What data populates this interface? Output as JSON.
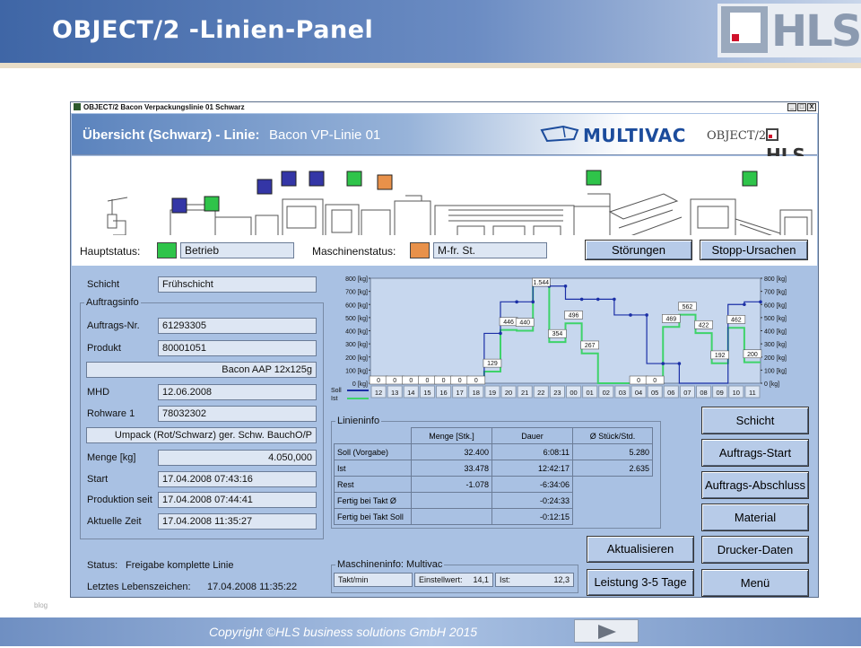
{
  "slide": {
    "title": "OBJECT/2 -Linien-Panel",
    "logo_text": "HLS",
    "footer_copyright": "Copyright ©HLS business solutions GmbH 2015",
    "blog_mark": "blog"
  },
  "window": {
    "title": "OBJECT/2 Bacon Verpackungslinie 01 Schwarz",
    "btn_min": "_",
    "btn_max": "□",
    "btn_close": "X"
  },
  "header": {
    "overview_label": "Übersicht (Schwarz) -  Linie:",
    "line_name": "Bacon VP-Linie 01",
    "brand": "MULTIVAC",
    "product_logo": "OBJECT/2",
    "hls_logo": "HLS"
  },
  "status": {
    "haupt_label": "Hauptstatus:",
    "haupt_value": "Betrieb",
    "haupt_color": "#2fc44a",
    "maschine_label": "Maschinenstatus:",
    "maschine_value": "M-fr. St.",
    "maschine_color": "#e8914a",
    "stoerungen": "Störungen",
    "stopp": "Stopp-Ursachen"
  },
  "machine_markers": {
    "blue": "#3436a6",
    "green": "#2fc44a",
    "orange": "#e8914a"
  },
  "left": {
    "schicht_label": "Schicht",
    "schicht_value": "Frühschicht",
    "auftragsinfo": "Auftragsinfo",
    "auftrag_label": "Auftrags-Nr.",
    "auftrag_value": "61293305",
    "produkt_label": "Produkt",
    "produkt_value": "80001051",
    "produkt_desc": "Bacon AAP 12x125g",
    "mhd_label": "MHD",
    "mhd_value": "12.06.2008",
    "rohware_label": "Rohware 1",
    "rohware_value": "78032302",
    "rohware_desc": "Umpack (Rot/Schwarz) ger. Schw. BauchO/P",
    "menge_label": "Menge [kg]",
    "menge_value": "4.050,000",
    "start_label": "Start",
    "start_value": "17.04.2008 07:43:16",
    "prod_label": "Produktion seit",
    "prod_value": "17.04.2008 07:44:41",
    "zeit_label": "Aktuelle Zeit",
    "zeit_value": "17.04.2008 11:35:27",
    "status_label": "Status:",
    "status_value": "Freigabe komplette Linie",
    "leben_label": "Letztes Lebenszeichen:",
    "leben_value": "17.04.2008 11:35:22"
  },
  "linieninfo": {
    "title": "Linieninfo",
    "headers": [
      "Menge [Stk.]",
      "Dauer",
      "Ø Stück/Std."
    ],
    "rows": [
      {
        "label": "Soll (Vorgabe)",
        "c1": "32.400",
        "c2": "6:08:11",
        "c3": "5.280"
      },
      {
        "label": "Ist",
        "c1": "33.478",
        "c2": "12:42:17",
        "c3": "2.635"
      },
      {
        "label": "Rest",
        "c1": "-1.078",
        "c2": "-6:34:06",
        "c3": ""
      },
      {
        "label": "Fertig bei Takt Ø",
        "c1": "",
        "c2": "-0:24:33",
        "c3": ""
      },
      {
        "label": "Fertig bei Takt Soll",
        "c1": "",
        "c2": "-0:12:15",
        "c3": ""
      }
    ]
  },
  "maschineninfo": {
    "title": "Maschineninfo: Multivac",
    "takt_label": "Takt/min",
    "einstell_label": "Einstellwert:",
    "einstell_value": "14,1",
    "ist_label": "Ist:",
    "ist_value": "12,3"
  },
  "buttons": {
    "schicht": "Schicht",
    "auftrags_start": "Auftrags-Start",
    "auftrags_abschluss": "Auftrags-Abschluss",
    "material": "Material",
    "drucker": "Drucker-Daten",
    "menu": "Menü",
    "aktualisieren": "Aktualisieren",
    "leistung": "Leistung 3-5 Tage"
  },
  "chart_data": {
    "type": "line",
    "y_unit": "[kg]",
    "ylim": [
      0,
      800
    ],
    "yticks": [
      "800 [kg]",
      "700 [kg]",
      "600 [kg]",
      "500 [kg]",
      "400 [kg]",
      "300 [kg]",
      "200 [kg]",
      "100 [kg]",
      "0 [kg]"
    ],
    "categories": [
      "12",
      "13",
      "14",
      "15",
      "16",
      "17",
      "18",
      "19",
      "20",
      "21",
      "22",
      "23",
      "00",
      "01",
      "02",
      "03",
      "04",
      "05",
      "06",
      "07",
      "08",
      "09",
      "10",
      "11"
    ],
    "legend": {
      "soll": "Soll",
      "ist": "Ist",
      "soll_color": "#1b2fa6",
      "ist_color": "#3ed36a"
    },
    "series": [
      {
        "name": "Soll",
        "values": [
          0,
          0,
          0,
          0,
          0,
          0,
          0,
          380,
          620,
          620,
          740,
          740,
          640,
          640,
          640,
          520,
          520,
          150,
          150,
          0,
          0,
          0,
          600,
          620,
          650,
          650,
          650,
          650
        ]
      },
      {
        "name": "Ist",
        "values": [
          0,
          0,
          0,
          0,
          0,
          0,
          0,
          129,
          446,
          440,
          1544,
          354,
          496,
          267,
          0,
          0,
          0,
          0,
          0,
          0,
          469,
          562,
          422,
          192,
          462,
          200
        ]
      }
    ],
    "data_labels": [
      {
        "label": "0",
        "cat": 0
      },
      {
        "label": "0",
        "cat": 1
      },
      {
        "label": "0",
        "cat": 2
      },
      {
        "label": "0",
        "cat": 3
      },
      {
        "label": "0",
        "cat": 4
      },
      {
        "label": "0",
        "cat": 5
      },
      {
        "label": "0",
        "cat": 6
      },
      {
        "label": "129",
        "cat": 7
      },
      {
        "label": "446",
        "cat": 8
      },
      {
        "label": "440",
        "cat": 9
      },
      {
        "label": "1.544",
        "cat": 10
      },
      {
        "label": "354",
        "cat": 11
      },
      {
        "label": "496",
        "cat": 12
      },
      {
        "label": "267",
        "cat": 13
      },
      {
        "label": "0",
        "cat": 16
      },
      {
        "label": "0",
        "cat": 17
      },
      {
        "label": "469",
        "cat": 18
      },
      {
        "label": "562",
        "cat": 19
      },
      {
        "label": "422",
        "cat": 20
      },
      {
        "label": "192",
        "cat": 21
      },
      {
        "label": "462",
        "cat": 22
      },
      {
        "label": "200",
        "cat": 23
      }
    ],
    "label_values": [
      0,
      0,
      0,
      0,
      0,
      0,
      0,
      129,
      446,
      440,
      800,
      354,
      496,
      267,
      0,
      0,
      0,
      0,
      469,
      562,
      422,
      192,
      462,
      200
    ]
  }
}
